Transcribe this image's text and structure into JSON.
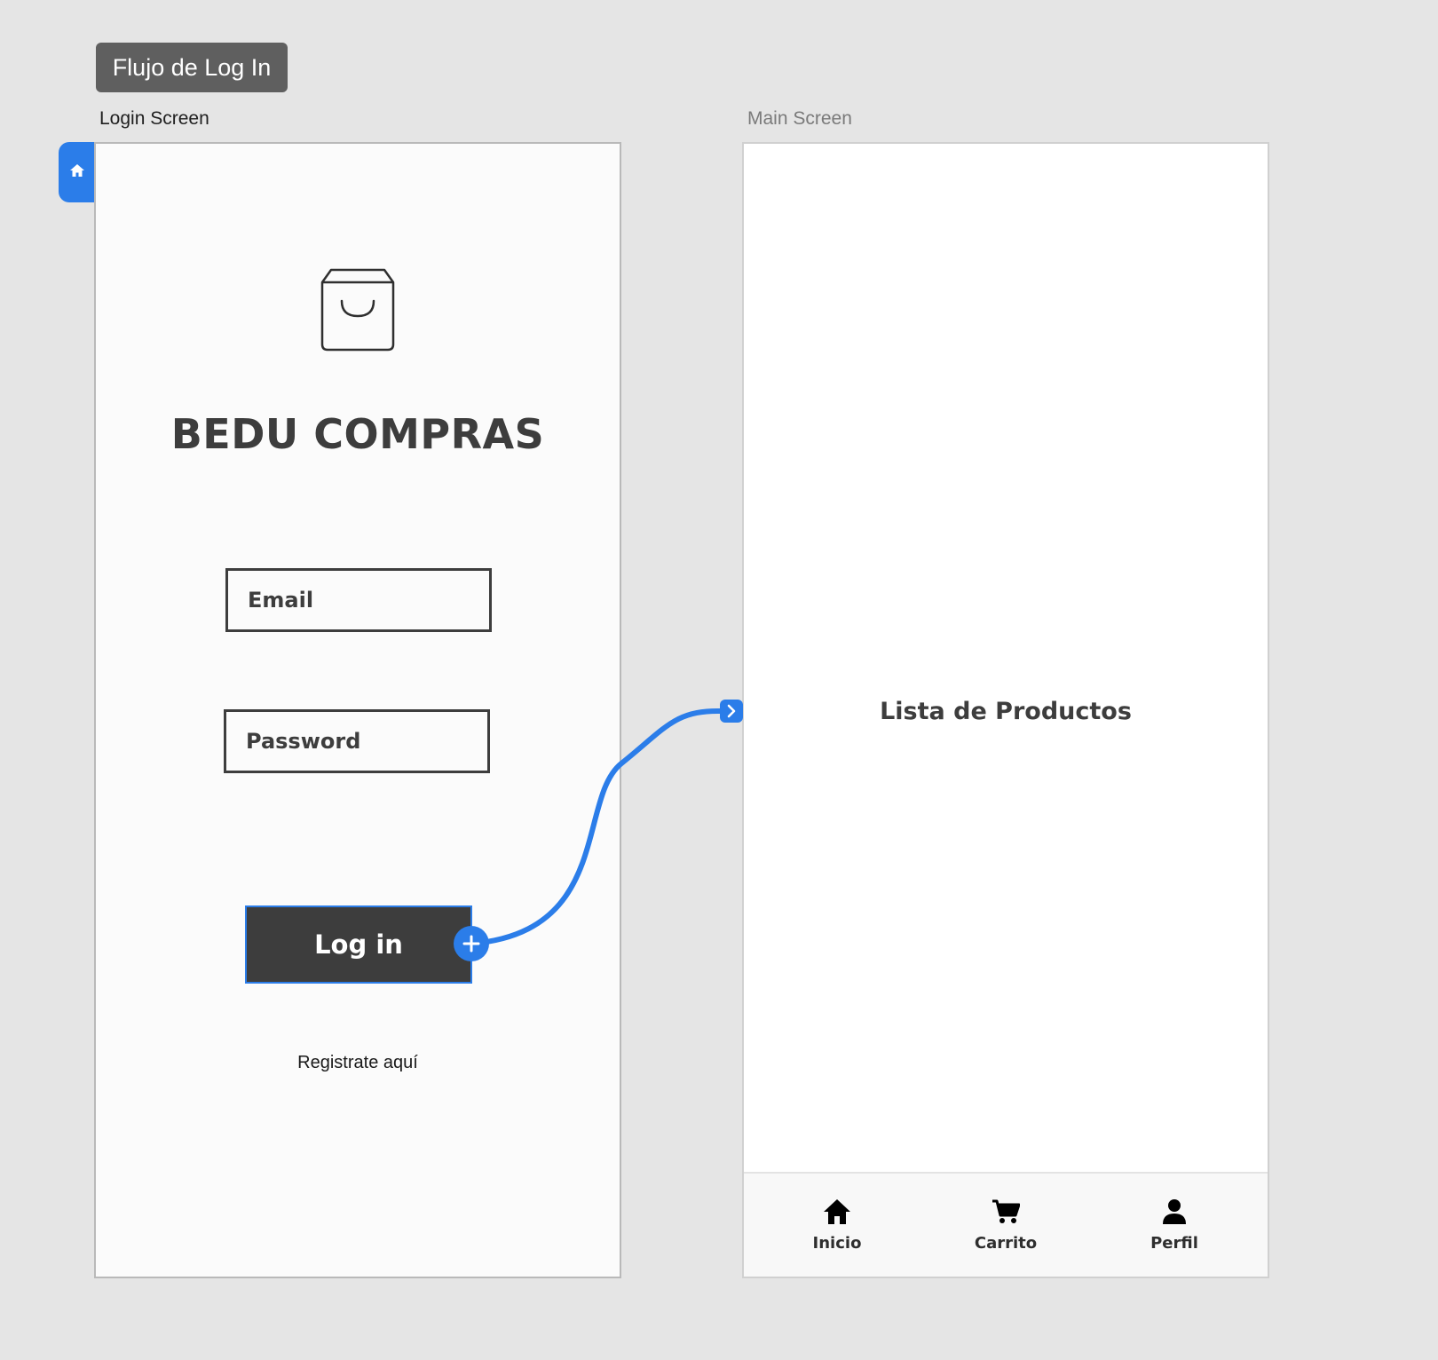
{
  "canvas": {
    "flow_tag": "Flujo de Log In",
    "login_artboard_label": "Login Screen",
    "main_artboard_label": "Main Screen"
  },
  "login_screen": {
    "title": "BEDU COMPRAS",
    "email_placeholder": "Email",
    "password_placeholder": "Password",
    "login_button_label": "Log in",
    "register_link": "Registrate aquí",
    "logo_icon": "shopping-bag-icon"
  },
  "main_screen": {
    "content_label": "Lista de Productos",
    "bottom_nav": {
      "items": [
        {
          "label": "Inicio",
          "icon": "home-icon"
        },
        {
          "label": "Carrito",
          "icon": "cart-icon"
        },
        {
          "label": "Perfil",
          "icon": "person-icon"
        }
      ]
    }
  },
  "colors": {
    "canvas_background": "#e5e5e5",
    "accent_blue": "#2b7de9",
    "dark_gray": "#3d3d3d",
    "tag_background": "#5f5f5f"
  },
  "icons": {
    "home_marker": "home-icon",
    "connection_start": "plus-icon",
    "connection_end": "chevron-right-icon"
  }
}
